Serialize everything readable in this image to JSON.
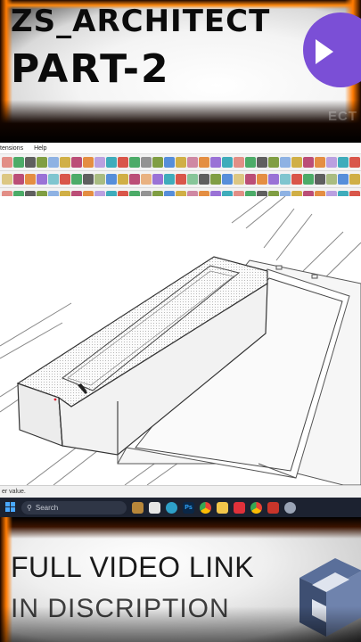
{
  "banner": {
    "title_line1": "ZS_ARCHITECT",
    "title_line2": "PART-2",
    "ghost_text": "ECT",
    "logo_color": "#7b4fd6"
  },
  "app": {
    "menu": [
      "tensions",
      "Help"
    ],
    "status_text": "er value."
  },
  "taskbar": {
    "search_placeholder": "Search",
    "icons": [
      "dragon-icon",
      "window-icon",
      "edge-icon",
      "photoshop-icon",
      "chrome-icon",
      "folder-icon",
      "autocad-icon",
      "chrome-2-icon",
      "sketchup-icon",
      "settings-icon"
    ]
  },
  "bottom": {
    "line1": "FULL VIDEO LINK",
    "line2": "IN DISCRIPTION"
  },
  "colors": {
    "fire": "#ff7a00",
    "taskbar": "#1c2230",
    "sketchup_red": "#d33a2c",
    "sketchup_blue": "#5a6f9a"
  }
}
